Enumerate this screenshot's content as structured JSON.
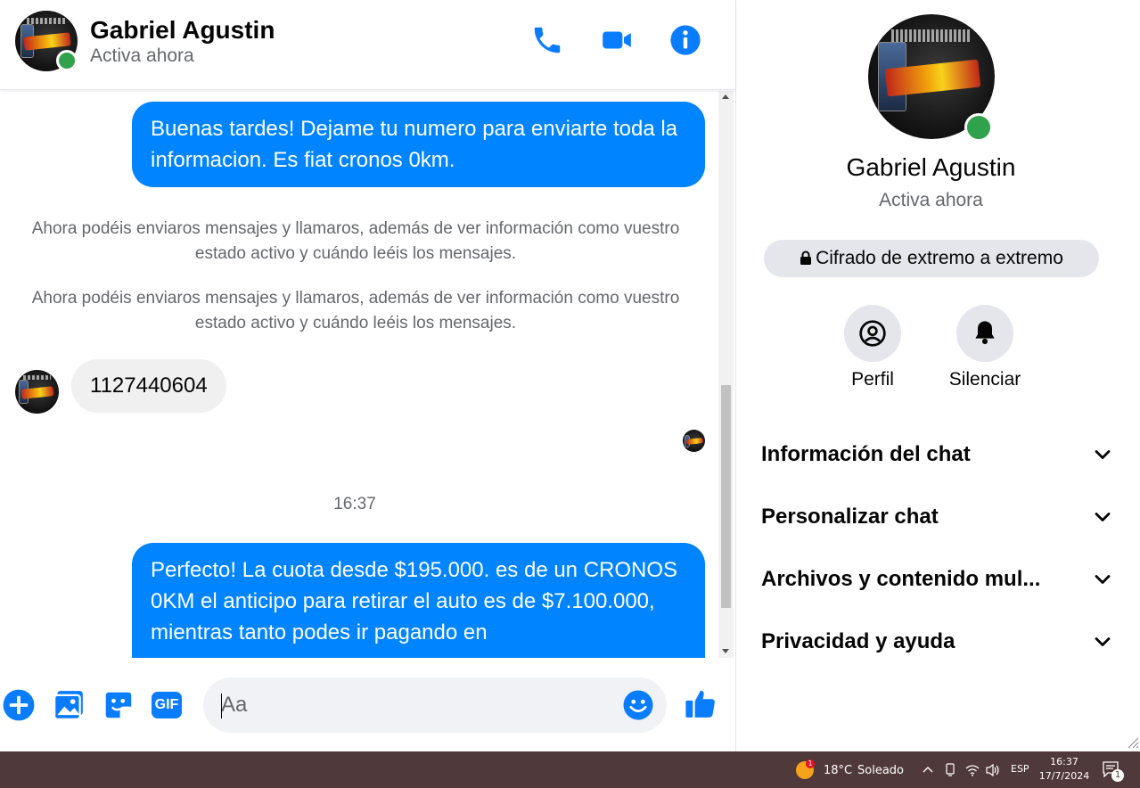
{
  "chat": {
    "contact_name": "Gabriel Agustin",
    "contact_status": "Activa ahora",
    "messages": {
      "m1": "Buenas tardes! Dejame tu numero para enviarte toda la informacion. Es fiat cronos 0km.",
      "sys1": "Ahora podéis enviaros mensajes y llamaros, además de ver información como vuestro estado activo y cuándo leéis los mensajes.",
      "sys2": "Ahora podéis enviaros mensajes y llamaros, además de ver información como vuestro estado activo y cuándo leéis los mensajes.",
      "m2": "1127440604",
      "time_sep": "16:37",
      "m3": "Perfecto! La cuota desde $195.000. es de un CRONOS 0KM el anticipo para retirar el auto es de $7.100.000, mientras tanto podes ir pagando en"
    },
    "composer": {
      "placeholder": "Aa"
    },
    "icons": {
      "call": "phone-icon",
      "video": "video-camera-icon",
      "info": "info-icon",
      "plus": "plus-circle-icon",
      "gallery": "gallery-icon",
      "sticker": "sticker-icon",
      "gif": "GIF",
      "emoji": "emoji-icon",
      "like": "thumbs-up-icon"
    }
  },
  "info_panel": {
    "name": "Gabriel Agustin",
    "status": "Activa ahora",
    "encryption": "Cifrado de extremo a extremo",
    "actions": [
      {
        "label": "Perfil",
        "icon": "profile-icon"
      },
      {
        "label": "Silenciar",
        "icon": "bell-icon"
      }
    ],
    "sections": [
      {
        "label": "Información del chat"
      },
      {
        "label": "Personalizar chat"
      },
      {
        "label": "Archivos y contenido mul..."
      },
      {
        "label": "Privacidad y ayuda"
      }
    ]
  },
  "taskbar": {
    "weather_temp": "18°C",
    "weather_desc": "Soleado",
    "weather_badge": "1",
    "language": "ESP",
    "time": "16:37",
    "date": "17/7/2024",
    "notification_count": "1"
  },
  "colors": {
    "accent": "#0084ff",
    "online": "#31a24c",
    "taskbar": "#50393a"
  }
}
